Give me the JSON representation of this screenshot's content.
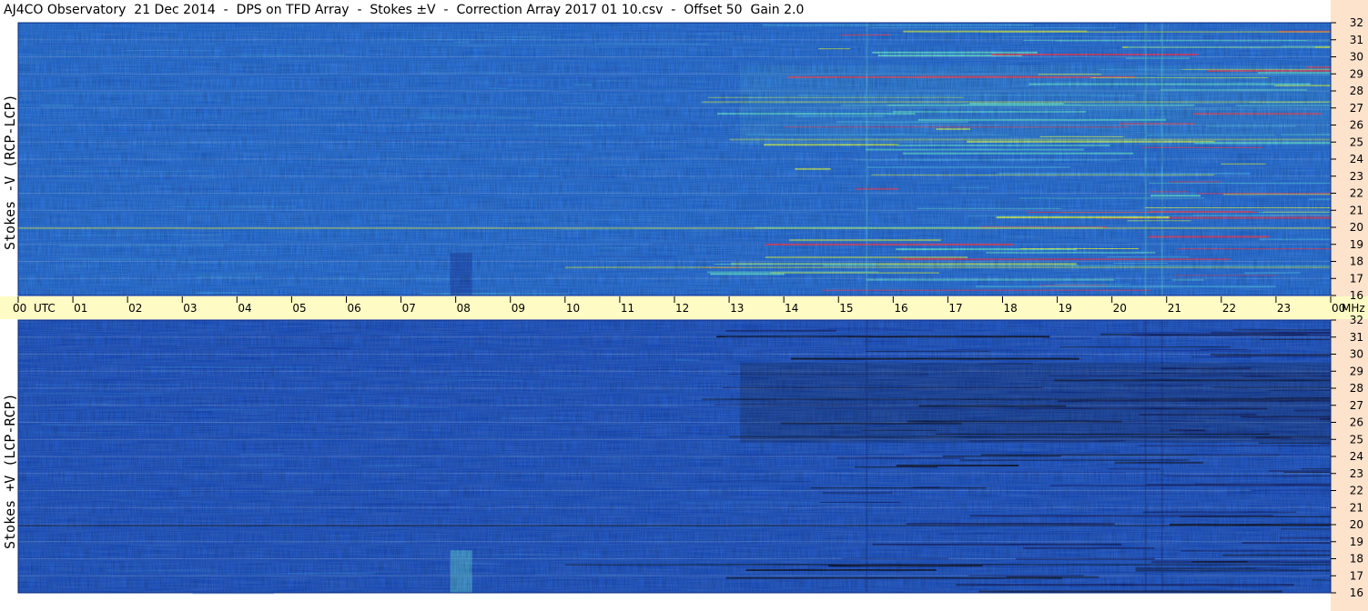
{
  "title": "AJ4CO Observatory  21 Dec 2014  -  DPS on TFD Array  -  Stokes ±V  -  Correction Array 2017 01 10.csv  -  Offset 50  Gain 2.0",
  "chart_data": [
    {
      "type": "heatmap",
      "panel": "top",
      "ylabel": "Stokes -V (RCP-LCP)",
      "yunit": "MHz",
      "ylim": [
        16,
        32
      ],
      "yticks": [
        "16",
        "17",
        "18",
        "19",
        "20",
        "21",
        "22",
        "23",
        "24",
        "25",
        "26",
        "27",
        "28",
        "29",
        "30",
        "31",
        "32"
      ],
      "xlim": [
        0,
        24
      ],
      "colormap": [
        "#0a0f60",
        "#0c2fa8",
        "#1a55d8",
        "#2b7bf0",
        "#3aa8f5",
        "#59e0e0",
        "#d8f850",
        "#ff3050"
      ],
      "background_color": "#1e6ee6"
    },
    {
      "type": "heatmap",
      "panel": "bottom",
      "ylabel": "Stokes +V (LCP-RCP)",
      "yunit": "MHz",
      "ylim": [
        16,
        32
      ],
      "yticks": [
        "16",
        "17",
        "18",
        "19",
        "20",
        "21",
        "22",
        "23",
        "24",
        "25",
        "26",
        "27",
        "28",
        "29",
        "30",
        "31",
        "32"
      ],
      "xlim": [
        0,
        24
      ],
      "colormap": [
        "#020826",
        "#0a1a70",
        "#0d3ab8",
        "#1654d4",
        "#2a7ae8",
        "#5ad6e0",
        "#d8f850"
      ],
      "background_color": "#1550d0"
    }
  ],
  "xaxis": {
    "label": "UTC",
    "ticks": [
      "00",
      "01",
      "02",
      "03",
      "04",
      "05",
      "06",
      "07",
      "08",
      "09",
      "10",
      "11",
      "12",
      "13",
      "14",
      "15",
      "16",
      "17",
      "18",
      "19",
      "20",
      "21",
      "22",
      "23",
      "00"
    ],
    "unit_label": "MHz",
    "band_color": "#fffbc4"
  },
  "colors": {
    "side_strip": "#fde2cc",
    "grid": "#c8d8ff"
  }
}
